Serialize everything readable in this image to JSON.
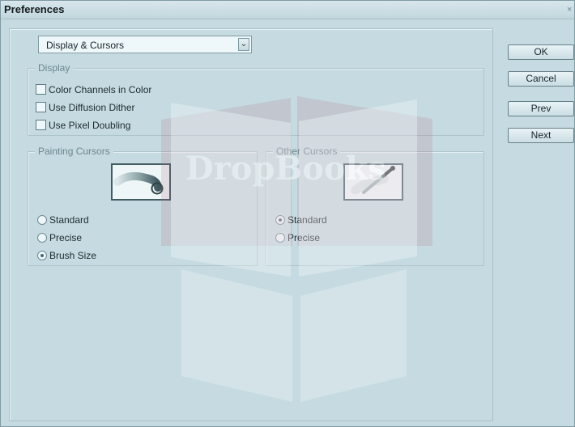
{
  "window": {
    "title": "Preferences"
  },
  "combo": {
    "selected": "Display & Cursors"
  },
  "display": {
    "title": "Display",
    "options": [
      "Color Channels in Color",
      "Use Diffusion Dither",
      "Use Pixel Doubling"
    ]
  },
  "painting_cursors": {
    "title": "Painting Cursors",
    "options": [
      "Standard",
      "Precise",
      "Brush Size"
    ],
    "selected": "Brush Size"
  },
  "other_cursors": {
    "title": "Other Cursors",
    "options": [
      "Standard",
      "Precise"
    ],
    "selected": "Standard"
  },
  "buttons": {
    "ok": "OK",
    "cancel": "Cancel",
    "prev": "Prev",
    "next": "Next"
  },
  "watermark": {
    "text": "DropBooks"
  },
  "colors": {
    "background": "#c6dbe1",
    "border": "#7f9aa2",
    "watermark_red": "#a56c83"
  }
}
